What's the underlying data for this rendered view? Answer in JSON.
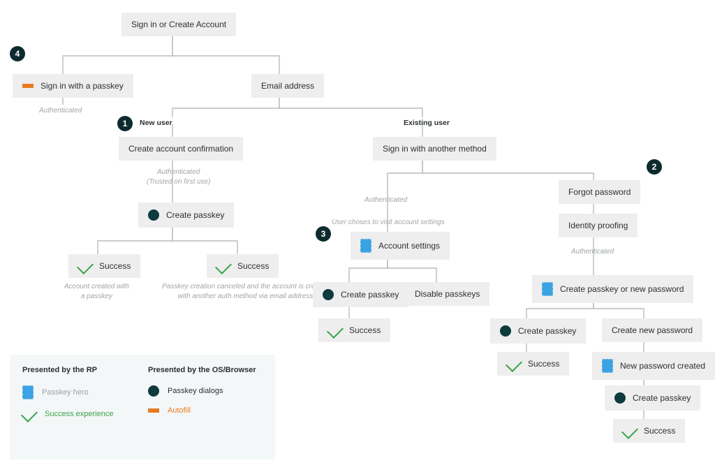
{
  "root": "Sign in or Create Account",
  "left": {
    "signin_passkey": "Sign in with a passkey",
    "authenticated": "Authenticated"
  },
  "email": "Email address",
  "new_user": {
    "label": "New user",
    "confirm": "Create account confirmation",
    "auth_trusted_l1": "Authenticated",
    "auth_trusted_l2": "(Trusted on first use)",
    "create_passkey": "Create passkey",
    "success_left": "Success",
    "success_right": "Success",
    "note_left_l1": "Account created with",
    "note_left_l2": "a passkey",
    "note_right_l1": "Passkey creation canceled and the account is created",
    "note_right_l2": "with another auth method via email address"
  },
  "existing": {
    "label": "Existing user",
    "another": "Sign in with another method",
    "auth": "Authenticated",
    "visit": "User choses to visit account settings",
    "settings": "Account settings",
    "create_passkey": "Create passkey",
    "disable": "Disable passkeys",
    "success": "Success"
  },
  "forgot": {
    "label": "Forgot password",
    "proof": "Identity proofing",
    "auth": "Authenticated",
    "choice": "Create passkey or new password",
    "create_passkey": "Create passkey",
    "create_newpw": "Create new password",
    "success_pk": "Success",
    "newpw_created": "New password created",
    "create_passkey2": "Create passkey",
    "success_final": "Success"
  },
  "badge": {
    "n1": "1",
    "n2": "2",
    "n3": "3",
    "n4": "4"
  },
  "legend": {
    "rp": "Presented by the RP",
    "os": "Presented by the OS/Browser",
    "hero": "Passkey hero",
    "success": "Success experience",
    "dialogs": "Passkey dialogs",
    "autofill": "Autofill"
  }
}
